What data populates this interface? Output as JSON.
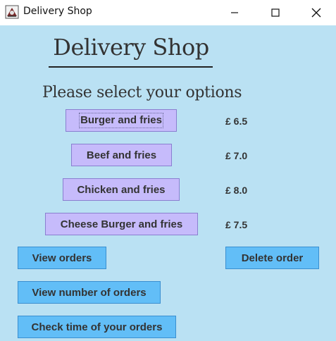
{
  "window": {
    "title": "Delivery Shop",
    "icon": "java-app-icon",
    "controls": [
      "minimize-icon",
      "maximize-icon",
      "close-icon"
    ]
  },
  "main": {
    "heading": "Delivery Shop",
    "subheading": "Please select your options"
  },
  "menu": {
    "items": [
      {
        "label": "Burger and fries",
        "price": "£ 6.5"
      },
      {
        "label": "Beef and fries",
        "price": "£ 7.0"
      },
      {
        "label": "Chicken and fries",
        "price": "£ 8.0"
      },
      {
        "label": "Cheese Burger and fries",
        "price": "£ 7.5"
      }
    ]
  },
  "actions": {
    "view_orders": "View orders",
    "delete_order": "Delete order",
    "view_number": "View number of orders",
    "check_time": "Check time of your orders"
  },
  "colors": {
    "background": "#bae1f3",
    "menu_button": "#c6bbfb",
    "action_button": "#62bef7",
    "text": "#333333"
  }
}
